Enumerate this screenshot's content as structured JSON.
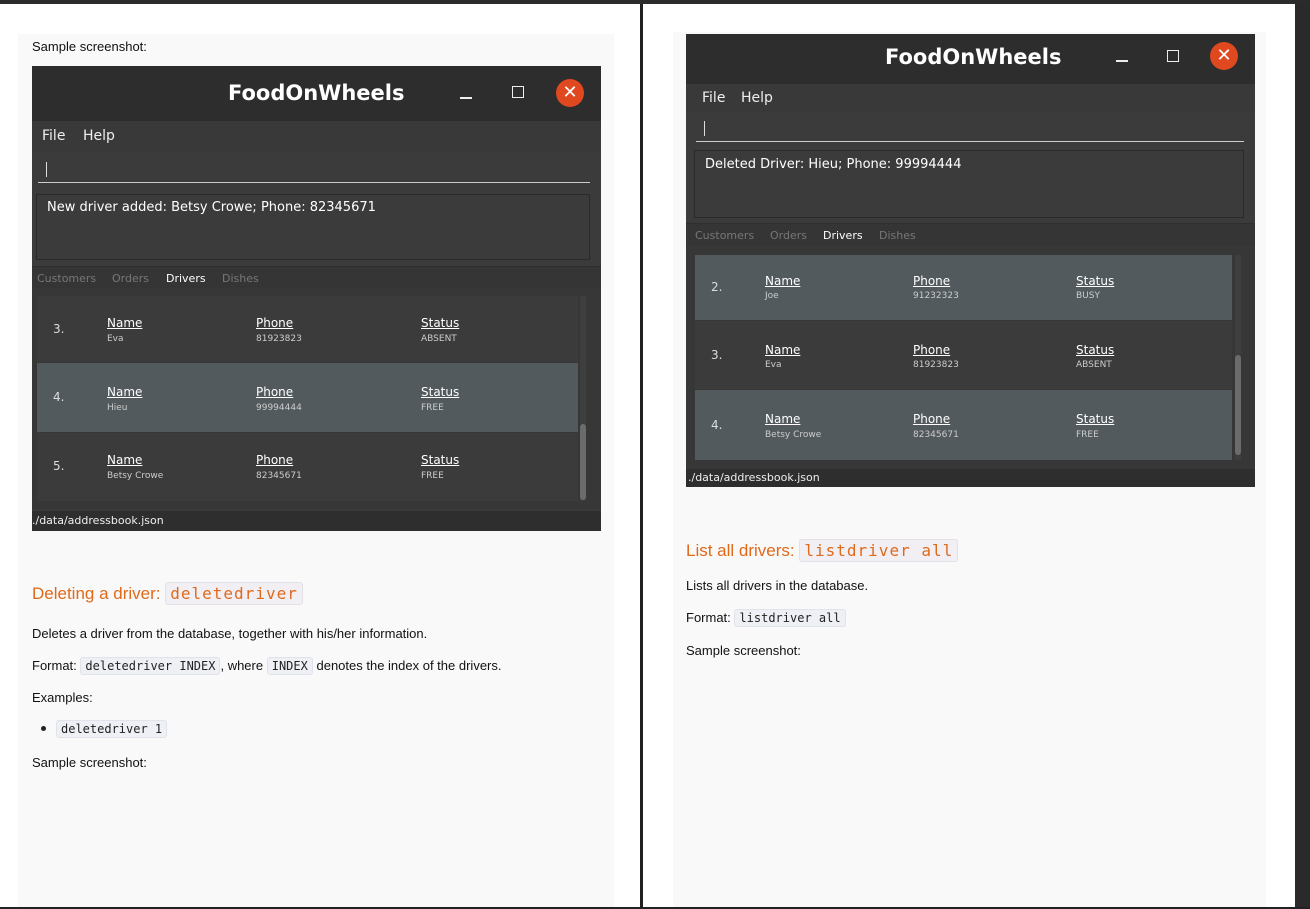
{
  "left": {
    "caption_top": "Sample screenshot:",
    "app": {
      "title": "FoodOnWheels",
      "menu": [
        "File",
        "Help"
      ],
      "result": "New driver added: Betsy Crowe; Phone: 82345671",
      "tabs": [
        "Customers",
        "Orders",
        "Drivers",
        "Dishes"
      ],
      "active_tab": "Drivers",
      "rows": [
        {
          "index": "3.",
          "name_label": "Name",
          "name": "Eva",
          "phone_label": "Phone",
          "phone": "81923823",
          "status_label": "Status",
          "status": "ABSENT"
        },
        {
          "index": "4.",
          "name_label": "Name",
          "name": "Hieu",
          "phone_label": "Phone",
          "phone": "99994444",
          "status_label": "Status",
          "status": "FREE"
        },
        {
          "index": "5.",
          "name_label": "Name",
          "name": "Betsy Crowe",
          "phone_label": "Phone",
          "phone": "82345671",
          "status_label": "Status",
          "status": "FREE"
        }
      ],
      "status_path": "./data/addressbook.json"
    },
    "section_heading": "Deleting a driver:",
    "section_cmd": "deletedriver",
    "desc": "Deletes a driver from the database, together with his/her information.",
    "format_label": "Format:",
    "format_code": "deletedriver INDEX",
    "format_mid": ", where",
    "format_code2": "INDEX",
    "format_end": "denotes the index of the drivers.",
    "examples_label": "Examples:",
    "example_1": "deletedriver 1",
    "caption_bottom": "Sample screenshot:"
  },
  "right": {
    "app": {
      "title": "FoodOnWheels",
      "menu": [
        "File",
        "Help"
      ],
      "result": "Deleted Driver: Hieu; Phone: 99994444",
      "tabs": [
        "Customers",
        "Orders",
        "Drivers",
        "Dishes"
      ],
      "active_tab": "Drivers",
      "rows": [
        {
          "index": "2.",
          "name_label": "Name",
          "name": "Joe",
          "phone_label": "Phone",
          "phone": "91232323",
          "status_label": "Status",
          "status": "BUSY"
        },
        {
          "index": "3.",
          "name_label": "Name",
          "name": "Eva",
          "phone_label": "Phone",
          "phone": "81923823",
          "status_label": "Status",
          "status": "ABSENT"
        },
        {
          "index": "4.",
          "name_label": "Name",
          "name": "Betsy Crowe",
          "phone_label": "Phone",
          "phone": "82345671",
          "status_label": "Status",
          "status": "FREE"
        }
      ],
      "status_path": "./data/addressbook.json"
    },
    "section_heading": "List all drivers:",
    "section_cmd": "listdriver all",
    "desc": "Lists all drivers in the database.",
    "format_label": "Format:",
    "format_code": "listdriver all",
    "caption_bottom": "Sample screenshot:"
  },
  "colors": {
    "accent": "#e0691a",
    "close_button": "#e0491f",
    "row_highlight": "#525a5e"
  }
}
